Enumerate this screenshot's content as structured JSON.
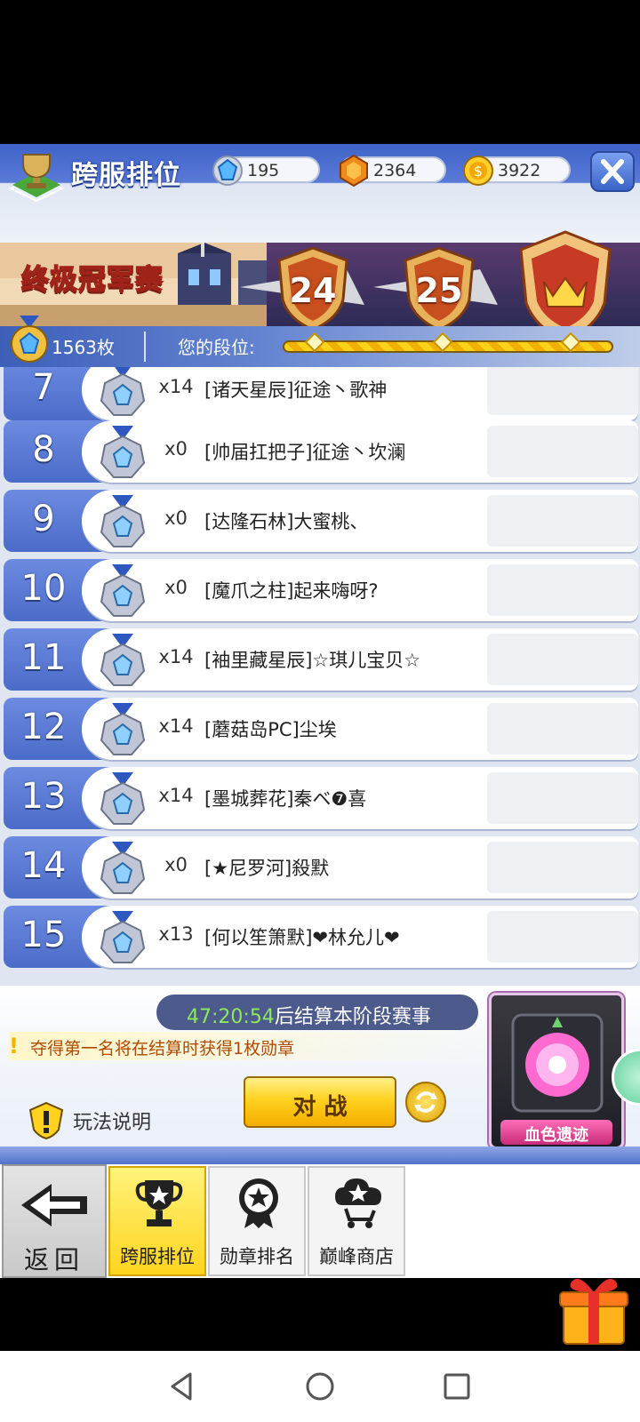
{
  "header": {
    "title": "跨服排位",
    "currencies": [
      {
        "icon": "blue-gem-icon",
        "value": "195"
      },
      {
        "icon": "orange-gem-icon",
        "value": "2364"
      },
      {
        "icon": "gold-coin-icon",
        "value": "3922"
      }
    ],
    "close_icon": "close-icon"
  },
  "banner": {
    "event_title": "终极冠军赛",
    "rank_levels": [
      "24",
      "25"
    ],
    "top_badge_icon": "crown-icon"
  },
  "progress": {
    "medal_count": "1563枚",
    "your_rank_label": "您的段位:"
  },
  "list": {
    "rows": [
      {
        "rank": "7",
        "medals": "x14",
        "name": "[诸天星辰]征途丶歌神"
      },
      {
        "rank": "8",
        "medals": "x0",
        "name": "[帅届扛把子]征途丶坎澜"
      },
      {
        "rank": "9",
        "medals": "x0",
        "name": "[达隆石林]大蜜桃、"
      },
      {
        "rank": "10",
        "medals": "x0",
        "name": "[魔爪之柱]起来嗨呀?"
      },
      {
        "rank": "11",
        "medals": "x14",
        "name": "[袖里藏星辰]☆琪儿宝贝☆"
      },
      {
        "rank": "12",
        "medals": "x14",
        "name": "[蘑菇岛PC]尘埃"
      },
      {
        "rank": "13",
        "medals": "x14",
        "name": "[墨城葬花]秦ベ❼喜"
      },
      {
        "rank": "14",
        "medals": "x0",
        "name": "[★尼罗河]殺默"
      },
      {
        "rank": "15",
        "medals": "x13",
        "name": "[何以笙箫默]❤林允儿❤"
      }
    ]
  },
  "bottom": {
    "timer_value": "47:20:54",
    "timer_suffix": "后结算本阶段赛事",
    "hint": "夺得第一名将在结算时获得1枚勋章",
    "rules_label": "玩法说明",
    "battle_label": "对 战",
    "portal_label": "血色遗迹"
  },
  "tabs": {
    "back_label": "返回",
    "items": [
      {
        "label": "跨服排位",
        "icon": "trophy-icon",
        "active": true
      },
      {
        "label": "勋章排名",
        "icon": "medal-star-icon",
        "active": false
      },
      {
        "label": "巅峰商店",
        "icon": "shop-cart-icon",
        "active": false
      }
    ]
  },
  "colors": {
    "accent_blue": "#4b6bc9",
    "gold": "#ffd21f",
    "timer_green": "#8de85b"
  }
}
